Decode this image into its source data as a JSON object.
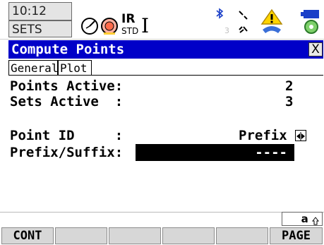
{
  "statusbar": {
    "time": "10:12",
    "set": "SETS",
    "mode_ir": "IR",
    "mode_std": "STD",
    "cursor_char": "I",
    "channel_num": "3",
    "icons": [
      "compass-icon",
      "prism-target-icon",
      "bluetooth-icon",
      "radio-link-icon",
      "warning-person-icon",
      "battery-icon",
      "storage-card-icon"
    ]
  },
  "titlebar": {
    "title": "Compute Points",
    "close": "X"
  },
  "tabs": [
    {
      "label": "General",
      "active": true
    },
    {
      "label": "Plot",
      "active": false
    }
  ],
  "fields": {
    "points_active": {
      "label": "Points Active:",
      "value": "2"
    },
    "sets_active": {
      "label": "Sets Active  :",
      "value": "3"
    },
    "point_id": {
      "label": "Point ID     :",
      "value": "Prefix"
    },
    "prefix_suffix": {
      "label": "Prefix/Suffix:",
      "value": "----"
    }
  },
  "keyboard_indicator": "a",
  "softkeys": [
    "CONT",
    "",
    "",
    "",
    "",
    "PAGE"
  ],
  "colors": {
    "title_bg": "#0000c8",
    "title_fg": "#ffffff"
  }
}
